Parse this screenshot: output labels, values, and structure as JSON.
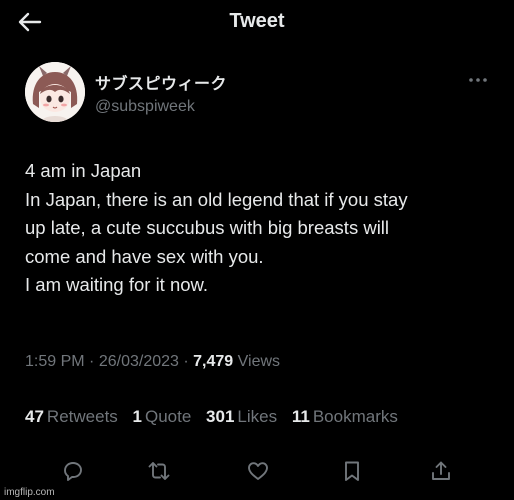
{
  "header": {
    "title": "Tweet",
    "back_icon": "arrow-left-icon"
  },
  "author": {
    "display_name": "サブスピウィーク",
    "handle": "@subspiweek",
    "avatar_icon": "anime-avatar"
  },
  "tweet": {
    "lines": [
      "4 am in Japan",
      "In Japan, there is an old legend that if you stay",
      "up late, a cute succubus with big breasts will",
      "come and have sex with you.",
      "I am waiting for it now."
    ]
  },
  "meta": {
    "time": "1:59 PM",
    "date": "26/03/2023",
    "views_count": "7,479",
    "views_label": "Views",
    "separator": "·"
  },
  "stats": {
    "retweets_count": "47",
    "retweets_label": "Retweets",
    "quotes_count": "1",
    "quotes_label": "Quote",
    "likes_count": "301",
    "likes_label": "Likes",
    "bookmarks_count": "11",
    "bookmarks_label": "Bookmarks"
  },
  "actions": [
    "reply-icon",
    "retweet-icon",
    "like-icon",
    "bookmark-icon",
    "share-icon"
  ],
  "watermark": "imgflip.com",
  "colors": {
    "background": "#000000",
    "primary_text": "#e7e9ea",
    "secondary_text": "#71767b"
  }
}
